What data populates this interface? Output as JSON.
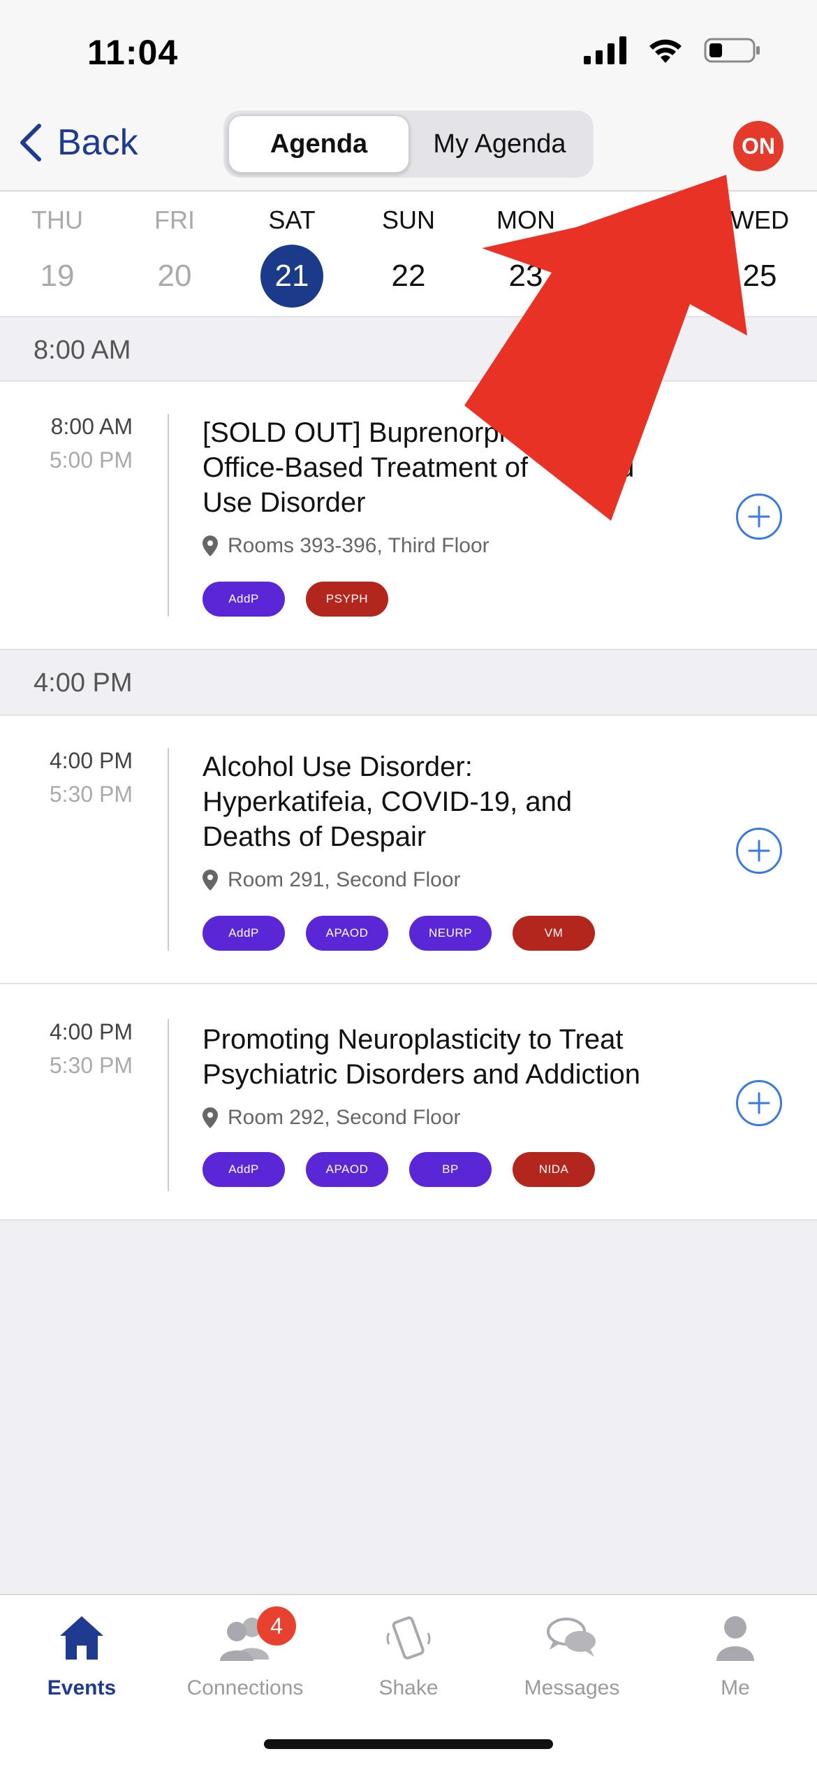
{
  "status_bar": {
    "time": "11:04"
  },
  "nav": {
    "back_label": "Back",
    "segments": [
      "Agenda",
      "My Agenda"
    ],
    "active_segment": "Agenda",
    "on_label": "ON"
  },
  "dates": [
    {
      "dow": "THU",
      "num": "19",
      "state": "past"
    },
    {
      "dow": "FRI",
      "num": "20",
      "state": "past"
    },
    {
      "dow": "SAT",
      "num": "21",
      "state": "selected"
    },
    {
      "dow": "SUN",
      "num": "22",
      "state": "future"
    },
    {
      "dow": "MON",
      "num": "23",
      "state": "future"
    },
    {
      "dow": "WED",
      "num": "25",
      "state": "future"
    }
  ],
  "sections": [
    {
      "header": "8:00 AM",
      "sessions": [
        {
          "start": "8:00 AM",
          "end": "5:00 PM",
          "title_lines": [
            "[SOLD OUT] Buprenorphi",
            "Office-Based Treatment of",
            "Use Disorder"
          ],
          "title_fragment_right": "id",
          "location": "Rooms 393-396, Third Floor",
          "tags": [
            {
              "label": "AddP",
              "color": "#5b27d6"
            },
            {
              "label": "PSYPH",
              "color": "#b3261e"
            }
          ]
        }
      ]
    },
    {
      "header": "4:00 PM",
      "sessions": [
        {
          "start": "4:00 PM",
          "end": "5:30 PM",
          "title_lines": [
            "Alcohol Use Disorder:",
            "Hyperkatifeia, COVID-19, and",
            "Deaths of Despair"
          ],
          "location": "Room 291, Second Floor",
          "tags": [
            {
              "label": "AddP",
              "color": "#5b27d6"
            },
            {
              "label": "APAOD",
              "color": "#5b27d6"
            },
            {
              "label": "NEURP",
              "color": "#5b27d6"
            },
            {
              "label": "VM",
              "color": "#b3261e"
            }
          ]
        },
        {
          "start": "4:00 PM",
          "end": "5:30 PM",
          "title_lines": [
            "Promoting Neuroplasticity to Treat",
            "Psychiatric Disorders and Addiction"
          ],
          "location": "Room 292, Second Floor",
          "tags": [
            {
              "label": "AddP",
              "color": "#5b27d6"
            },
            {
              "label": "APAOD",
              "color": "#5b27d6"
            },
            {
              "label": "BP",
              "color": "#5b27d6"
            },
            {
              "label": "NIDA",
              "color": "#b3261e"
            }
          ]
        }
      ]
    }
  ],
  "tabs": [
    {
      "label": "Events",
      "icon": "home-icon",
      "active": true
    },
    {
      "label": "Connections",
      "icon": "people-icon",
      "badge": "4"
    },
    {
      "label": "Shake",
      "icon": "phone-shake-icon"
    },
    {
      "label": "Messages",
      "icon": "chat-bubbles-icon"
    },
    {
      "label": "Me",
      "icon": "person-icon"
    }
  ],
  "colors": {
    "brand": "#1f3b8f",
    "accent_red": "#e33a2b",
    "add_blue": "#3a7ae0"
  }
}
